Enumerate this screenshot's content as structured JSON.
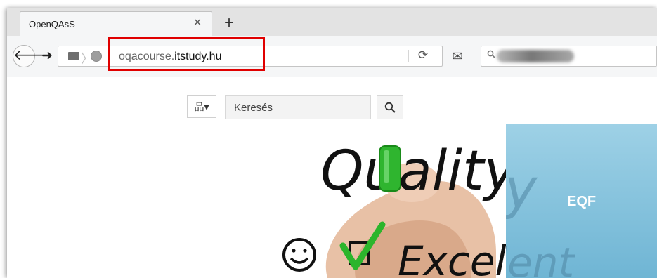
{
  "browser": {
    "tab_title": "OpenQAsS",
    "tab_close": "×",
    "new_tab": "+",
    "back": "🡐",
    "forward": "➜",
    "url_prefix": "oqacourse.",
    "url_domain": "itstudy.hu",
    "reload": "⟳",
    "mail": "✉",
    "search_icon": "🔍"
  },
  "page": {
    "sitemap_label": "品▾",
    "search_placeholder": "Keresés",
    "search_button": "🔍",
    "hero_word_1": "Quality",
    "hero_word_2": "Excellent",
    "eqf_label": "EQF"
  },
  "colors": {
    "highlight": "#e00000",
    "eqf_panel": "#8ac6df",
    "checkbox": "#2cb52c"
  }
}
